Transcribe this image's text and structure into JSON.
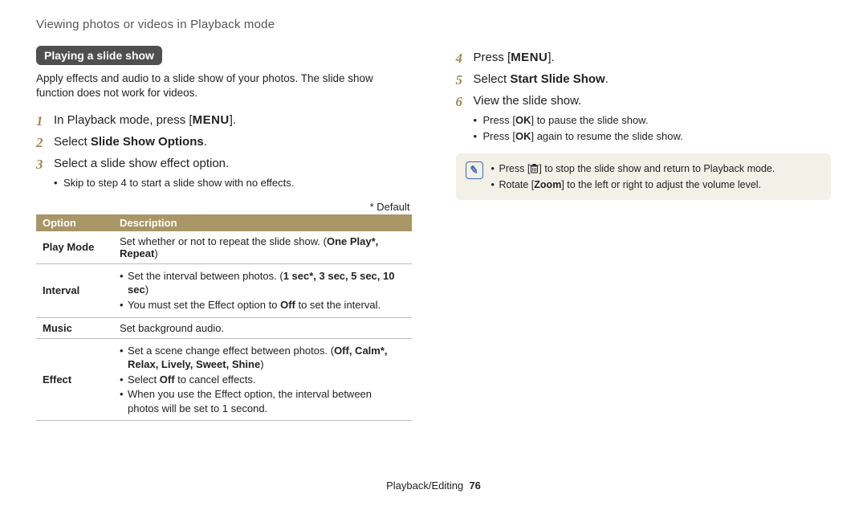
{
  "breadcrumb": "Viewing photos or videos in Playback mode",
  "badge": "Playing a slide show",
  "intro": "Apply effects and audio to a slide show of your photos. The slide show function does not work for videos.",
  "menuGlyph": "MENU",
  "okGlyph": "OK",
  "stepsLeft": {
    "s1_a": "In Playback mode, press [",
    "s1_b": "].",
    "s2_a": "Select ",
    "s2_bold": "Slide Show Options",
    "s2_b": ".",
    "s3": "Select a slide show effect option.",
    "s3_sub": "Skip to step 4 to start a slide show with no effects."
  },
  "defaultNote": "* Default",
  "tableHead": {
    "c1": "Option",
    "c2": "Description"
  },
  "rows": {
    "playMode": {
      "label": "Play Mode",
      "text_a": "Set whether or not to repeat the slide show. (",
      "opts": "One Play*, Repeat",
      "text_b": ")"
    },
    "interval": {
      "label": "Interval",
      "b1_a": "Set the interval between photos. (",
      "b1_opts": "1 sec*, 3 sec, 5 sec, 10 sec",
      "b1_b": ")",
      "b2_a": "You must set the Effect option to ",
      "b2_bold": "Off",
      "b2_b": " to set the interval."
    },
    "music": {
      "label": "Music",
      "text": "Set background audio."
    },
    "effect": {
      "label": "Effect",
      "b1_a": "Set a scene change effect between photos. (",
      "b1_opts": "Off, Calm*, Relax, Lively, Sweet, Shine",
      "b1_b": ")",
      "b2_a": "Select ",
      "b2_bold": "Off",
      "b2_b": " to cancel effects.",
      "b3": "When you use the Effect option, the interval between photos will be set to 1 second."
    }
  },
  "stepsRight": {
    "s4_a": "Press [",
    "s4_b": "].",
    "s5_a": "Select ",
    "s5_bold": "Start Slide Show",
    "s5_b": ".",
    "s6": "View the slide show.",
    "s6_sub1_a": "Press [",
    "s6_sub1_b": "] to pause the slide show.",
    "s6_sub2_a": "Press [",
    "s6_sub2_b": "] again to resume the slide show."
  },
  "note": {
    "line1_a": "Press [",
    "line1_b": "] to stop the slide show and return to Playback mode.",
    "line2_a": "Rotate [",
    "line2_bold": "Zoom",
    "line2_b": "] to the left or right to adjust the volume level."
  },
  "footer": {
    "section": "Playback/Editing",
    "page": "76"
  }
}
